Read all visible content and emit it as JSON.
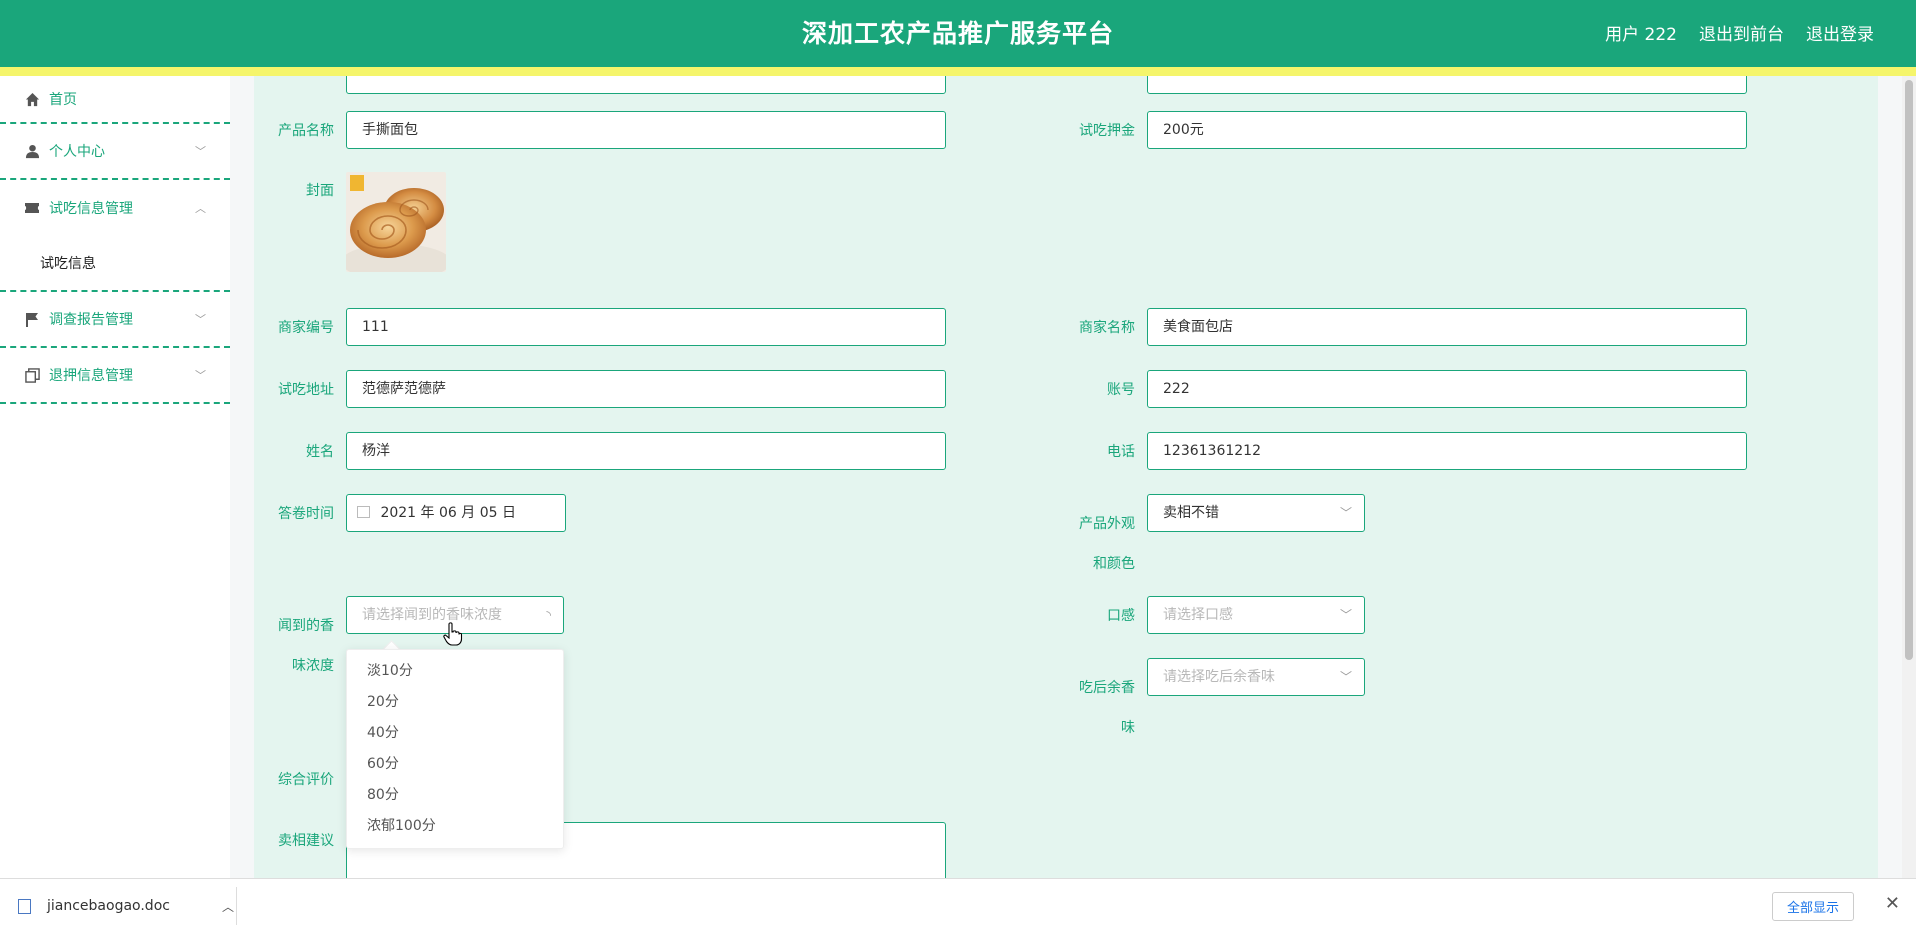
{
  "header": {
    "title": "深加工农产品推广服务平台",
    "user": "用户 222",
    "to_front": "退出到前台",
    "logout": "退出登录"
  },
  "sidebar": {
    "items": [
      {
        "label": "首页",
        "icon": "home-icon"
      },
      {
        "label": "个人中心",
        "icon": "user-icon"
      },
      {
        "label": "试吃信息管理",
        "icon": "ticket-icon"
      },
      {
        "label": "调查报告管理",
        "icon": "flag-icon"
      },
      {
        "label": "退押信息管理",
        "icon": "copy-icon"
      }
    ],
    "sub": "试吃信息"
  },
  "form": {
    "product_name": {
      "label": "产品名称",
      "value": "手撕面包"
    },
    "deposit": {
      "label": "试吃押金",
      "value": "200元"
    },
    "cover": {
      "label": "封面"
    },
    "merchant_no": {
      "label": "商家编号",
      "value": "111"
    },
    "merchant_name": {
      "label": "商家名称",
      "value": "美食面包店"
    },
    "address": {
      "label": "试吃地址",
      "value": "范德萨范德萨"
    },
    "account": {
      "label": "账号",
      "value": "222"
    },
    "name": {
      "label": "姓名",
      "value": "杨洋"
    },
    "phone": {
      "label": "电话",
      "value": "12361361212"
    },
    "date": {
      "label": "答卷时间",
      "value": "2021 年 06 月 05 日"
    },
    "appearance": {
      "label_1": "产品外观",
      "label_2": "和颜色",
      "value": "卖相不错"
    },
    "aroma": {
      "label_1": "闻到的香",
      "label_2": "味浓度",
      "placeholder": "请选择闻到的香味浓度"
    },
    "taste": {
      "label": "口感",
      "placeholder": "请选择口感"
    },
    "aftertaste": {
      "label_1": "吃后余香",
      "label_2": "味",
      "placeholder": "请选择吃后余香味"
    },
    "overall": {
      "label": "综合评价"
    },
    "suggestion": {
      "label": "卖相建议"
    }
  },
  "dropdown": {
    "options": [
      "淡10分",
      "20分",
      "40分",
      "60分",
      "80分",
      "浓郁100分"
    ]
  },
  "downloads": {
    "file": "jiancebaogao.doc",
    "show_all": "全部显示"
  },
  "colors": {
    "primary": "#1aa67b",
    "stripe": "#f5f56b",
    "panel": "#e4f5ef"
  }
}
